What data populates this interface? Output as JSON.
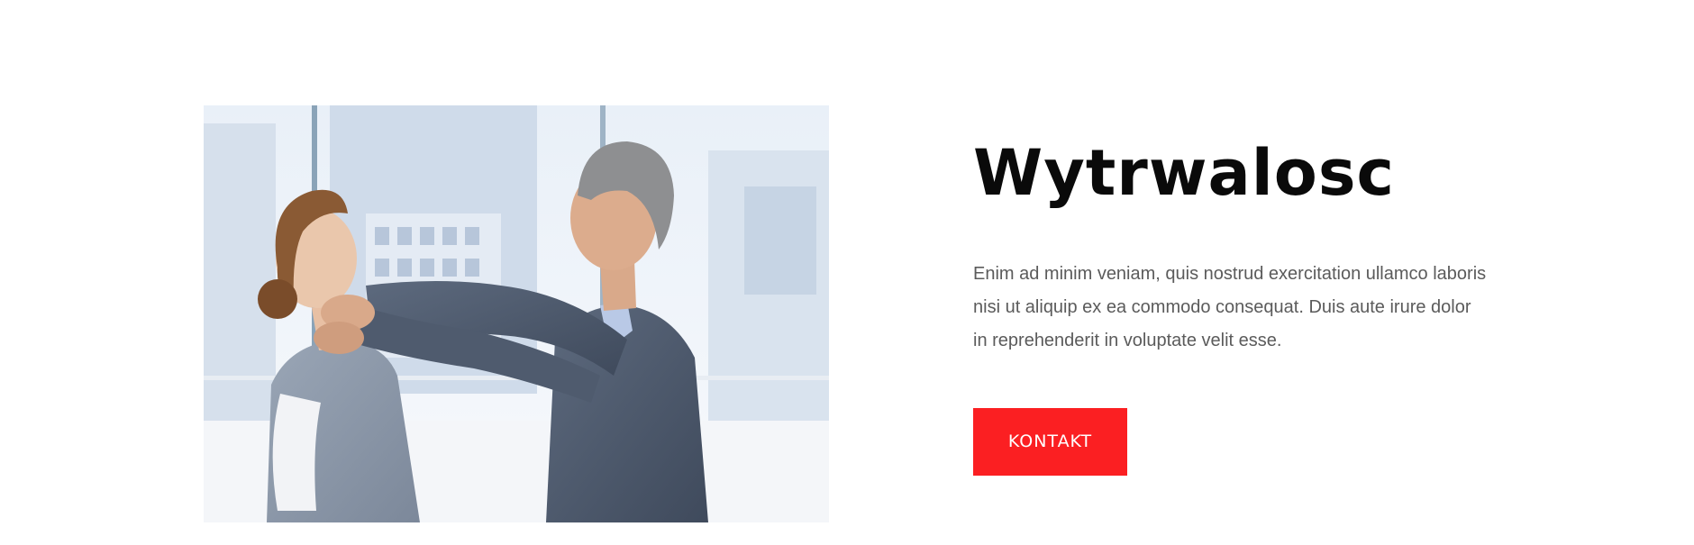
{
  "feature": {
    "image_alt": "Businessman holding a smiling woman by the neck in a bright office",
    "title": "Wytrwalosc",
    "description": "Enim ad minim veniam, quis nostrud exercitation ullamco laboris nisi ut aliquip ex ea commodo consequat. Duis aute irure dolor in reprehenderit in voluptate velit esse.",
    "cta_label": "KONTAKT"
  },
  "colors": {
    "accent": "#fb1f22",
    "title": "#0a0a0a",
    "body_text": "#5b5b5b",
    "background": "#ffffff"
  }
}
